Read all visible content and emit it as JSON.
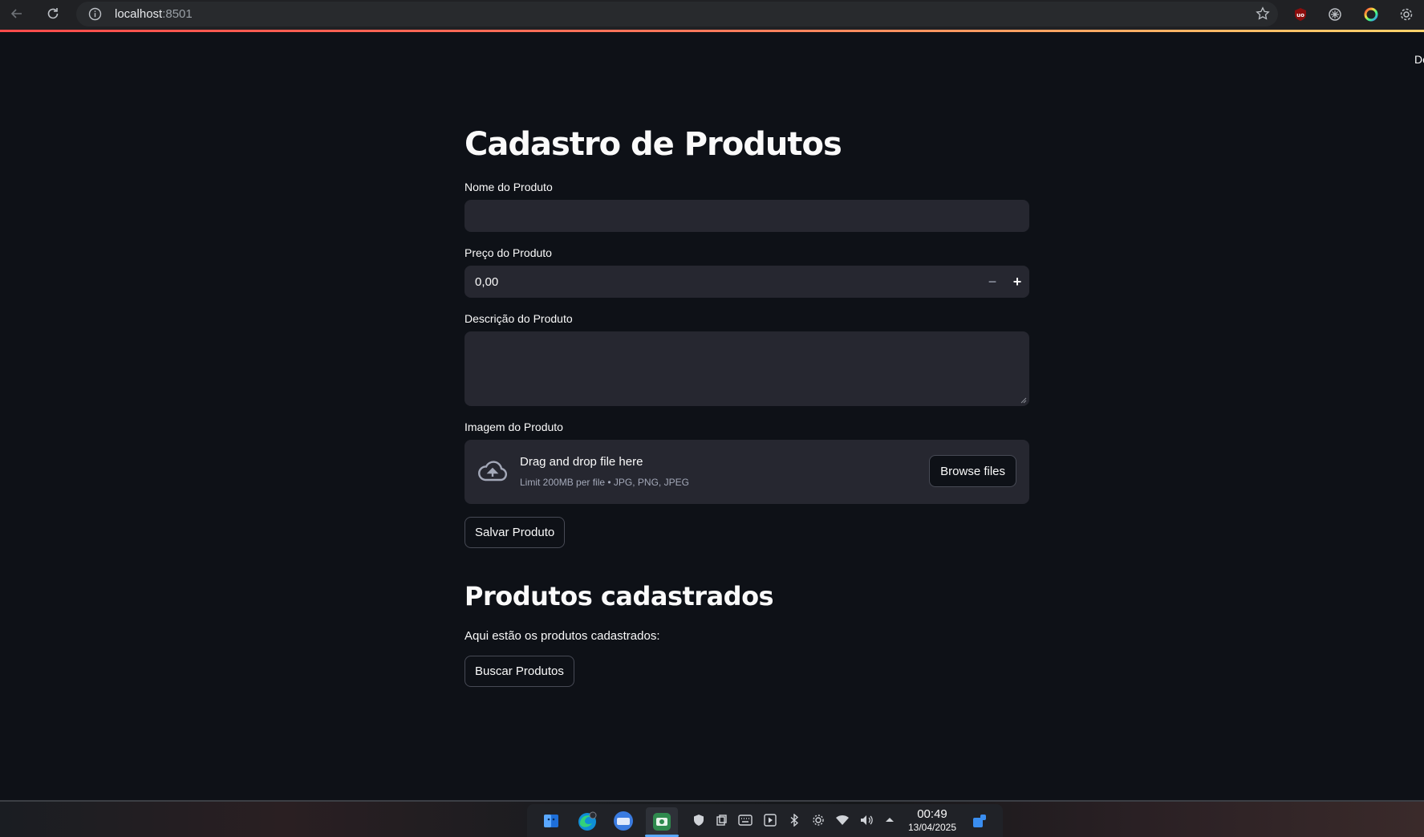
{
  "browser": {
    "url_host": "localhost",
    "url_port": ":8501",
    "back_icon": "arrow-left-icon",
    "reload_icon": "reload-icon"
  },
  "header": {
    "deploy_partial": "De"
  },
  "page": {
    "title": "Cadastro de Produtos",
    "fields": {
      "name_label": "Nome do Produto",
      "name_value": "",
      "price_label": "Preço do Produto",
      "price_value": "0,00",
      "price_minus": "−",
      "price_plus": "+",
      "description_label": "Descrição do Produto",
      "description_value": "",
      "image_label": "Imagem do Produto"
    },
    "uploader": {
      "drop_text": "Drag and drop file here",
      "limit_text": "Limit 200MB per file • JPG, PNG, JPEG",
      "browse_label": "Browse files"
    },
    "save_button": "Salvar Produto",
    "section_title": "Produtos cadastrados",
    "section_text": "Aqui estão os produtos cadastrados:",
    "search_button": "Buscar Produtos"
  },
  "colors": {
    "background": "#0e1117",
    "input_bg": "#262730",
    "accent_red": "#ff4b4b"
  },
  "taskbar": {
    "time": "00:49",
    "date": "13/04/2025"
  }
}
